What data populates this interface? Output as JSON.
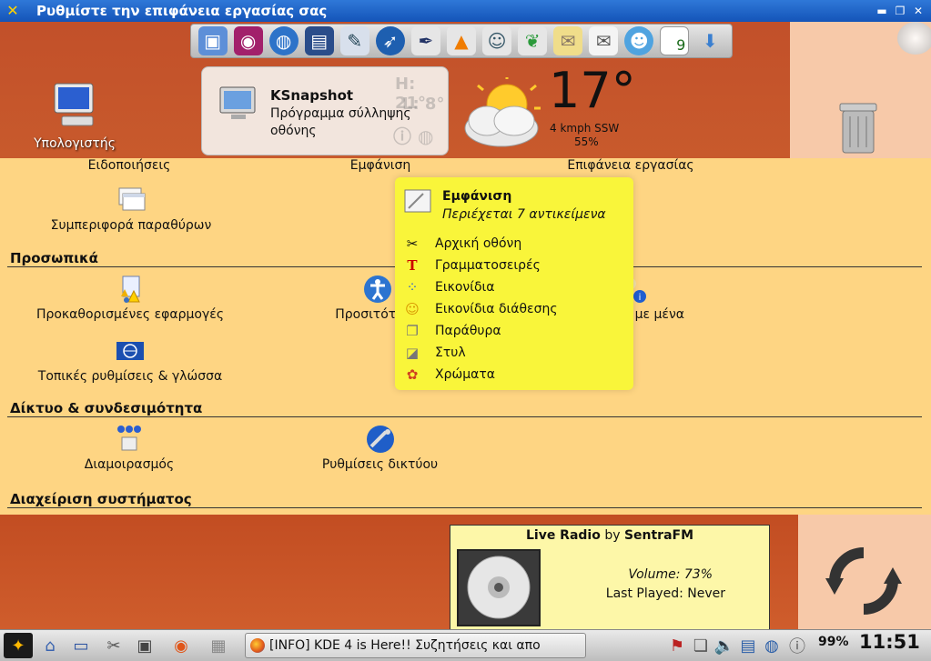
{
  "window": {
    "title": "Ρυθμίστε την επιφάνεια εργασίας σας"
  },
  "launcher": {
    "icons": [
      "screenshot-icon",
      "eye-icon",
      "globe-icon",
      "office-icon",
      "chat-icon",
      "network-icon",
      "ink-icon",
      "vlc-icon",
      "users-icon",
      "bird-icon",
      "folder-icon",
      "mail-icon",
      "smiley-icon",
      "sudoku-icon",
      "download-icon"
    ],
    "sudoku_digit": "9"
  },
  "desktop": {
    "computer_label": "Υπολογιστής"
  },
  "tooltip": {
    "title": "KSnapshot",
    "description": "Πρόγραμμα σύλληψης οθόνης"
  },
  "weather": {
    "temperature": "17°",
    "wind": "4 kmph SSW",
    "humidity": "55%"
  },
  "settings": {
    "top_items": [
      "Ειδοποιήσεις",
      "Εμφάνιση",
      "Επιφάνεια εργασίας"
    ],
    "window_behavior": "Συμπεριφορά παραθύρων",
    "sections": {
      "personal": "Προσωπικά",
      "network": "Δίκτυο & συνδεσιμότητα",
      "system": "Διαχείριση συστήματος"
    },
    "personal_items": {
      "default_apps": "Προκαθορισμένες εφαρμογές",
      "accessibility": "Προσιτότητα",
      "about_me": "Σχετικά με μένα",
      "locale": "Τοπικές ρυθμίσεις & γλώσσα"
    },
    "network_items": {
      "sharing": "Διαμοιρασμός",
      "network_settings": "Ρυθμίσεις δικτύου"
    }
  },
  "popup": {
    "title": "Εμφάνιση",
    "subtitle": "Περιέχεται 7 αντικείμενα",
    "items": [
      {
        "label": "Αρχική οθόνη",
        "icon": "tools-icon"
      },
      {
        "label": "Γραμματοσειρές",
        "icon": "font-icon"
      },
      {
        "label": "Εικονίδια",
        "icon": "icons-icon"
      },
      {
        "label": "Εικονίδια διάθεσης",
        "icon": "emoticon-icon"
      },
      {
        "label": "Παράθυρα",
        "icon": "window-icon"
      },
      {
        "label": "Στυλ",
        "icon": "style-icon"
      },
      {
        "label": "Χρώματα",
        "icon": "colors-icon"
      }
    ]
  },
  "radio": {
    "title_prefix": "Live Radio",
    "title_by": "by",
    "station": "SentraFM",
    "volume_label": "Volume:",
    "volume_value": "73%",
    "last_played_label": "Last Played:",
    "last_played_value": "Never"
  },
  "taskbar": {
    "task_title": "[INFO] KDE 4 is Here!! Συζητήσεις και απο",
    "battery": "99%",
    "clock": "11:51"
  },
  "colors": {
    "desktop_orange": "#c8552a",
    "panel_background": "#fed583",
    "popup_yellow": "#f9f53a",
    "titlebar_blue": "#1f63c8",
    "peach": "#f7c9a9"
  }
}
